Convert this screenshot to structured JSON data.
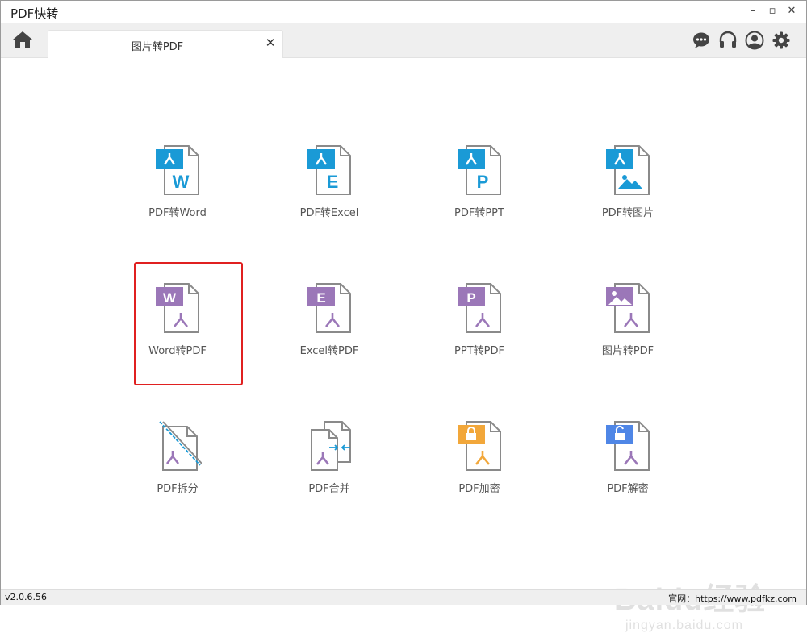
{
  "window": {
    "title": "PDF快转",
    "controls": {
      "minimize": "–",
      "maximize": "▫",
      "close": "✕"
    }
  },
  "toolbar": {
    "home_icon": "home-icon",
    "active_tab": {
      "label": "图片转PDF",
      "close": "✕"
    },
    "right_icons": [
      "chat-icon",
      "headset-icon",
      "user-icon",
      "gear-icon"
    ]
  },
  "colors": {
    "pdf_blue": "#1a9ad6",
    "office_purple": "#9b77b8",
    "lock_orange": "#f2a73a",
    "unlock_blue": "#4f86e6",
    "highlight_red": "#e02020"
  },
  "tools": [
    {
      "label": "PDF转Word",
      "badge": "W"
    },
    {
      "label": "PDF转Excel",
      "badge": "E"
    },
    {
      "label": "PDF转PPT",
      "badge": "P"
    },
    {
      "label": "PDF转图片",
      "badge": "image"
    },
    {
      "label": "Word转PDF",
      "badge": "W"
    },
    {
      "label": "Excel转PDF",
      "badge": "E"
    },
    {
      "label": "PPT转PDF",
      "badge": "P"
    },
    {
      "label": "图片转PDF",
      "badge": "image"
    },
    {
      "label": "PDF拆分",
      "badge": "split"
    },
    {
      "label": "PDF合并",
      "badge": "merge"
    },
    {
      "label": "PDF加密",
      "badge": "lock"
    },
    {
      "label": "PDF解密",
      "badge": "unlock"
    }
  ],
  "selected_tool": "Word转PDF",
  "status": {
    "version": "v2.0.6.56",
    "website": "官网：https://www.pdfkz.com"
  },
  "watermark": {
    "main": "Baidu经验",
    "sub": "jingyan.baidu.com"
  }
}
